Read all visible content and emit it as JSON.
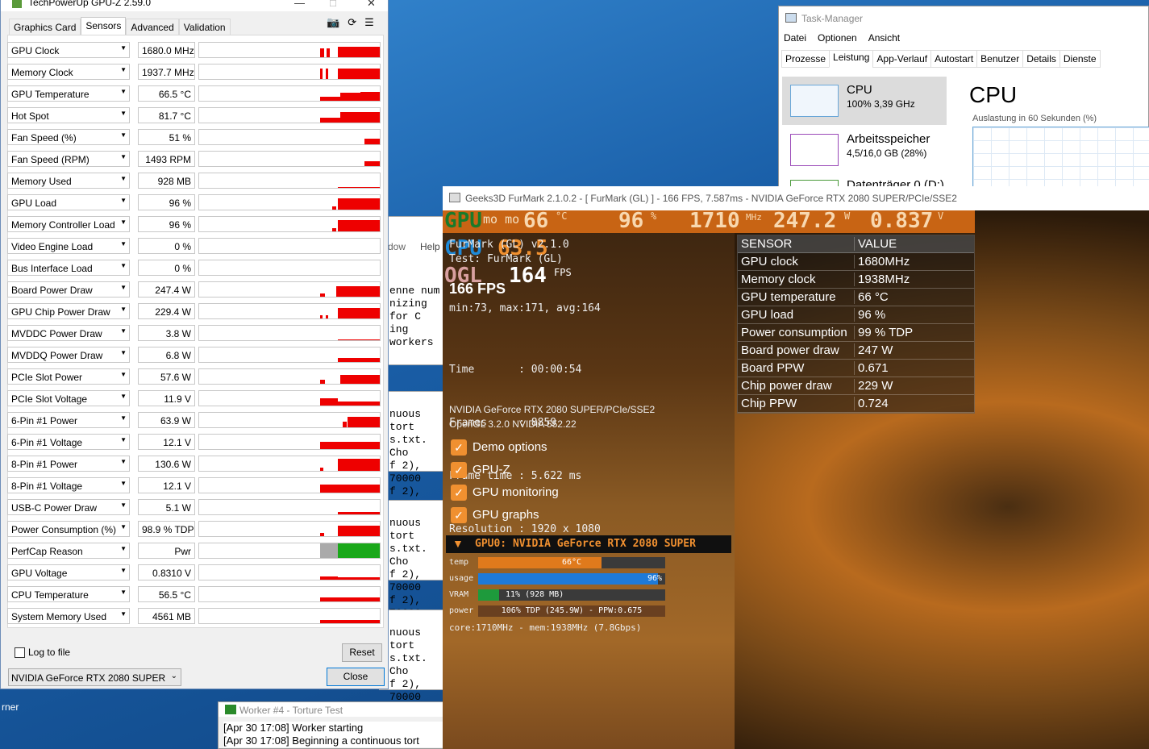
{
  "gpuz": {
    "title": "TechPowerUp GPU-Z 2.59.0",
    "tabs": [
      "Graphics Card",
      "Sensors",
      "Advanced",
      "Validation"
    ],
    "active_tab": "Sensors",
    "sensors": [
      {
        "name": "GPU Clock",
        "value": "1680.0 MHz"
      },
      {
        "name": "Memory Clock",
        "value": "1937.7 MHz"
      },
      {
        "name": "GPU Temperature",
        "value": "66.5 °C"
      },
      {
        "name": "Hot Spot",
        "value": "81.7 °C"
      },
      {
        "name": "Fan Speed (%)",
        "value": "51 %"
      },
      {
        "name": "Fan Speed (RPM)",
        "value": "1493 RPM"
      },
      {
        "name": "Memory Used",
        "value": "928 MB"
      },
      {
        "name": "GPU Load",
        "value": "96 %"
      },
      {
        "name": "Memory Controller Load",
        "value": "96 %"
      },
      {
        "name": "Video Engine Load",
        "value": "0 %"
      },
      {
        "name": "Bus Interface Load",
        "value": "0 %"
      },
      {
        "name": "Board Power Draw",
        "value": "247.4 W"
      },
      {
        "name": "GPU Chip Power Draw",
        "value": "229.4 W"
      },
      {
        "name": "MVDDC Power Draw",
        "value": "3.8 W"
      },
      {
        "name": "MVDDQ Power Draw",
        "value": "6.8 W"
      },
      {
        "name": "PCIe Slot Power",
        "value": "57.6 W"
      },
      {
        "name": "PCIe Slot Voltage",
        "value": "11.9 V"
      },
      {
        "name": "6-Pin #1 Power",
        "value": "63.9 W"
      },
      {
        "name": "6-Pin #1 Voltage",
        "value": "12.1 V"
      },
      {
        "name": "8-Pin #1 Power",
        "value": "130.6 W"
      },
      {
        "name": "8-Pin #1 Voltage",
        "value": "12.1 V"
      },
      {
        "name": "USB-C Power Draw",
        "value": "5.1 W"
      },
      {
        "name": "Power Consumption (%)",
        "value": "98.9 % TDP"
      },
      {
        "name": "PerfCap Reason",
        "value": "Pwr"
      },
      {
        "name": "GPU Voltage",
        "value": "0.8310 V"
      },
      {
        "name": "CPU Temperature",
        "value": "56.5 °C"
      },
      {
        "name": "System Memory Used",
        "value": "4561 MB"
      }
    ],
    "log_label": "Log to file",
    "reset_label": "Reset",
    "device": "NVIDIA GeForce RTX 2080 SUPER",
    "close_label": "Close"
  },
  "taskmgr": {
    "title": "Task-Manager",
    "menu": [
      "Datei",
      "Optionen",
      "Ansicht"
    ],
    "tabs": [
      "Prozesse",
      "Leistung",
      "App-Verlauf",
      "Autostart",
      "Benutzer",
      "Details",
      "Dienste"
    ],
    "active_tab": "Leistung",
    "cpu_label": "CPU",
    "cpu_sub": "100% 3,39 GHz",
    "mem_label": "Arbeitsspeicher",
    "mem_sub": "4,5/16,0 GB (28%)",
    "disk_label": "Datenträger 0 (D:)",
    "heading": "CPU",
    "graph_label": "Auslastung in 60 Sekunden (%)"
  },
  "furmark": {
    "title": "Geeks3D FurMark 2.1.0.2 - [ FurMark (GL) ] - 166 FPS, 7.587ms - NVIDIA GeForce RTX 2080 SUPER/PCIe/SSE2",
    "hud": {
      "gpu": "GPU",
      "gpu_temp": "66",
      "gpu_load": "96",
      "clock": "1710",
      "power": "247.2",
      "volt": "0.837",
      "cpu": "CPU",
      "cpu_temp": "63.5",
      "ogl": "OGL",
      "fps": "164",
      "fps_unit": "FPS",
      "demo": "mo mo",
      "mhz": "MHz"
    },
    "info": {
      "line1": "FurMark (GL) v2.1.0",
      "line2": "Test: FurMark (GL)",
      "fps_big": "166 FPS",
      "minmax": "min:73, max:171, avg:164",
      "time": "Time       : 00:00:54",
      "frames": "Frames     : 8859",
      "frametime": "Frame time : 5.622 ms",
      "resolution": "Resolution : 1920 x 1080",
      "gpu_str": "NVIDIA GeForce RTX 2080 SUPER/PCIe/SSE2",
      "gl_str": "OpenGL 3.2.0 NVIDIA 552.22"
    },
    "options": [
      "Demo options",
      "GPU-Z",
      "GPU monitoring",
      "GPU graphs"
    ],
    "gpu_header": "GPU0: NVIDIA GeForce RTX 2080 SUPER",
    "bars": [
      {
        "label": "temp",
        "text": "66°C",
        "fraction": 0.66,
        "color": "#e07a1c"
      },
      {
        "label": "usage",
        "text": "96%",
        "fraction": 0.96,
        "color": "#1e7ad8"
      },
      {
        "label": "VRAM",
        "text": "11% (928 MB)",
        "fraction": 0.11,
        "color": "#1e9a3c"
      },
      {
        "label": "power",
        "text": "106% TDP (245.9W) - PPW:0.675",
        "fraction": 1.0,
        "color": "#6a4020"
      }
    ],
    "core_line": "core:1710MHz - mem:1938MHz (7.8Gbps)",
    "table_header": [
      "SENSOR",
      "VALUE"
    ],
    "table": [
      [
        "GPU clock",
        "1680MHz"
      ],
      [
        "Memory clock",
        "1938MHz"
      ],
      [
        "GPU temperature",
        "66 °C"
      ],
      [
        "GPU load",
        "96 %"
      ],
      [
        "Power consumption",
        "99 % TDP"
      ],
      [
        "Board power draw",
        "247 W"
      ],
      [
        "Board PPW",
        "0.671"
      ],
      [
        "Chip power draw",
        "229 W"
      ],
      [
        "Chip PPW",
        "0.724"
      ]
    ]
  },
  "background": {
    "help": "Help",
    "dow": "dow",
    "lines": [
      "enne num",
      "nizing for C",
      "ing workers",
      "nuous tort",
      "s.txt.  Cho",
      "f 2), 70000",
      "f 2), 70000"
    ],
    "worker_title": "Worker #4 - Torture Test",
    "worker_lines": [
      "[Apr 30 17:08] Worker starting",
      "[Apr 30 17:08] Beginning a continuous tort"
    ],
    "desk_label": "rner"
  }
}
